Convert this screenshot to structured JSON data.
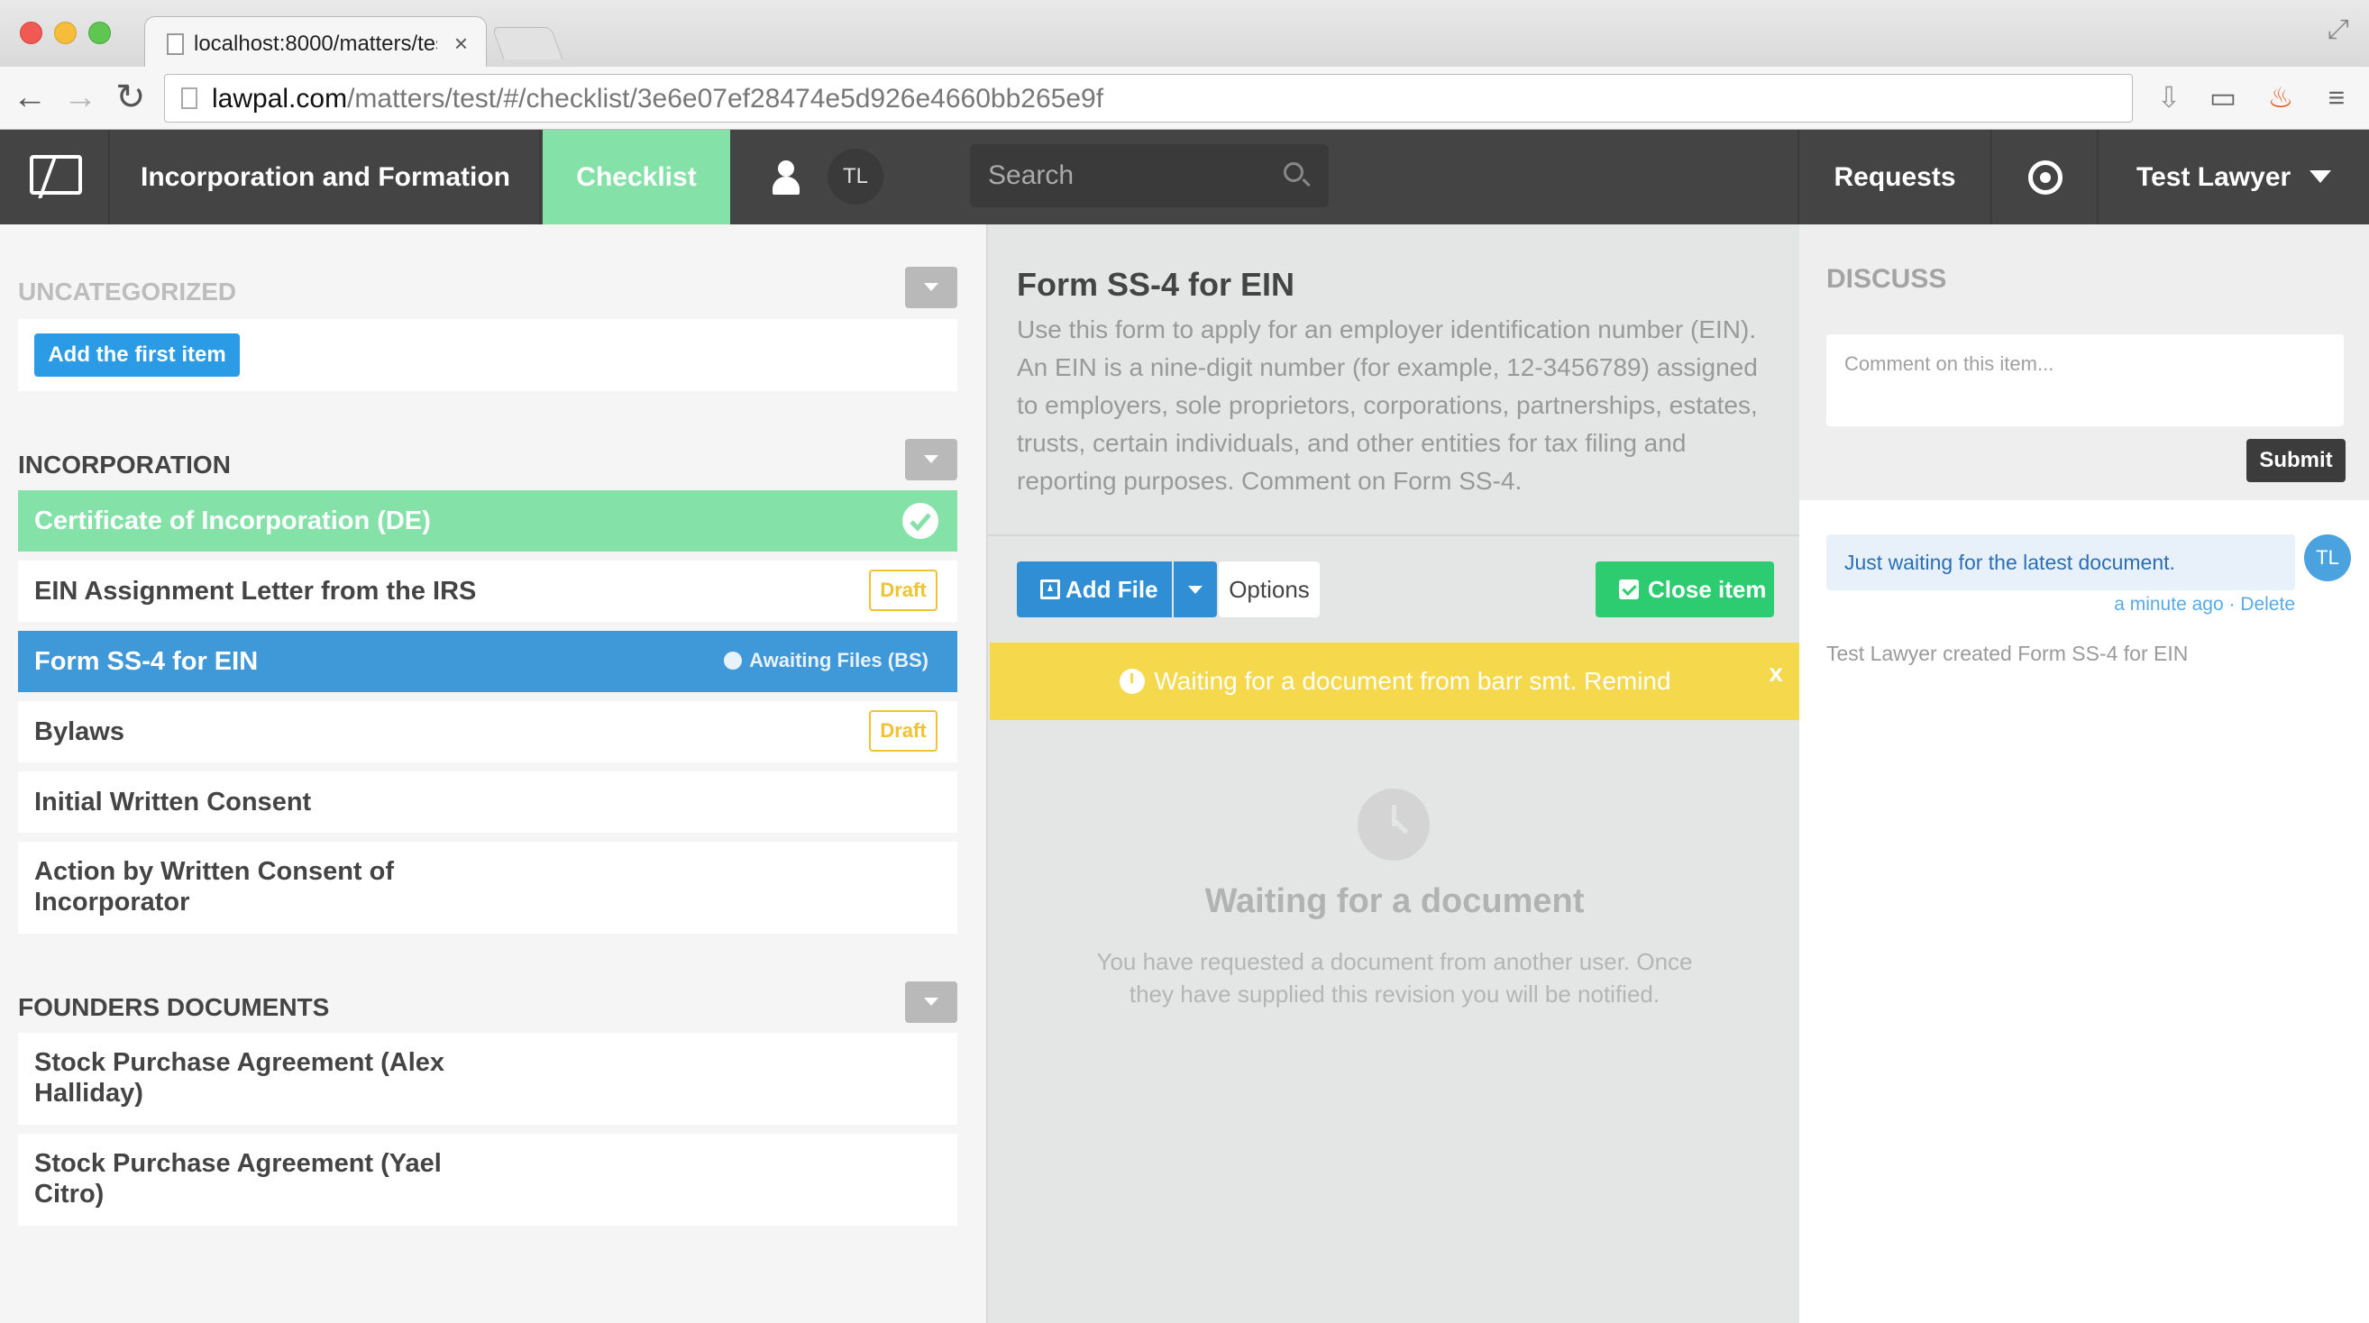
{
  "browser": {
    "tab_title": "localhost:8000/matters/test",
    "tab_close": "×",
    "url_host": "lawpal.com",
    "url_path": "/matters/test/#/checklist/3e6e07ef28474e5d926e4660bb265e9f"
  },
  "header": {
    "matter_title": "Incorporation and Formation",
    "active_tab": "Checklist",
    "avatar_initials": "TL",
    "search_placeholder": "Search",
    "requests_label": "Requests",
    "user_name": "Test Lawyer"
  },
  "checklist": {
    "categories": [
      {
        "name": "Uncategorized",
        "add_button": "Add the first item"
      },
      {
        "name": "Incorporation"
      },
      {
        "name": "Founders Documents"
      }
    ],
    "items": [
      {
        "label": "Certificate of Incorporation (DE)",
        "state": "complete"
      },
      {
        "label": "EIN Assignment Letter from the IRS",
        "badge": "Draft"
      },
      {
        "label": "Form SS-4 for EIN",
        "state": "selected",
        "status": "Awaiting Files (BS)"
      },
      {
        "label": "Bylaws",
        "badge": "Draft"
      },
      {
        "label": "Initial Written Consent"
      },
      {
        "label": "Action by Written Consent of Incorporator"
      },
      {
        "label": "Stock Purchase Agreement (Alex Halliday)"
      },
      {
        "label": "Stock Purchase Agreement (Yael Citro)"
      }
    ],
    "colors": {
      "complete": "#84e2a8",
      "selected": "#3f98d8",
      "draft": "#f1c232"
    }
  },
  "detail": {
    "title": "Form SS-4 for EIN",
    "description": "Use this form to apply for an employer identification number (EIN). An EIN is a nine-digit number (for example, 12-3456789) assigned to employers, sole proprietors, corporations, partnerships, estates, trusts, certain individuals, and other entities for tax filing and reporting purposes. Comment on Form SS-4.",
    "add_file_label": "Add File",
    "options_label": "Options",
    "close_item_label": "Close item",
    "banner_text": "Waiting for a document from barr smt. Remind",
    "banner_close": "x",
    "waiting_heading": "Waiting for a document",
    "waiting_text": "You have requested a document from another user. Once they have supplied this revision you will be notified."
  },
  "discuss": {
    "title": "Discuss",
    "comment_placeholder": "Comment on this item...",
    "submit_label": "Submit",
    "comment_text": "Just waiting for the latest document.",
    "comment_avatar": "TL",
    "comment_time": "a minute ago",
    "comment_delete": "Delete",
    "activity": "Test Lawyer created Form SS-4 for EIN"
  }
}
